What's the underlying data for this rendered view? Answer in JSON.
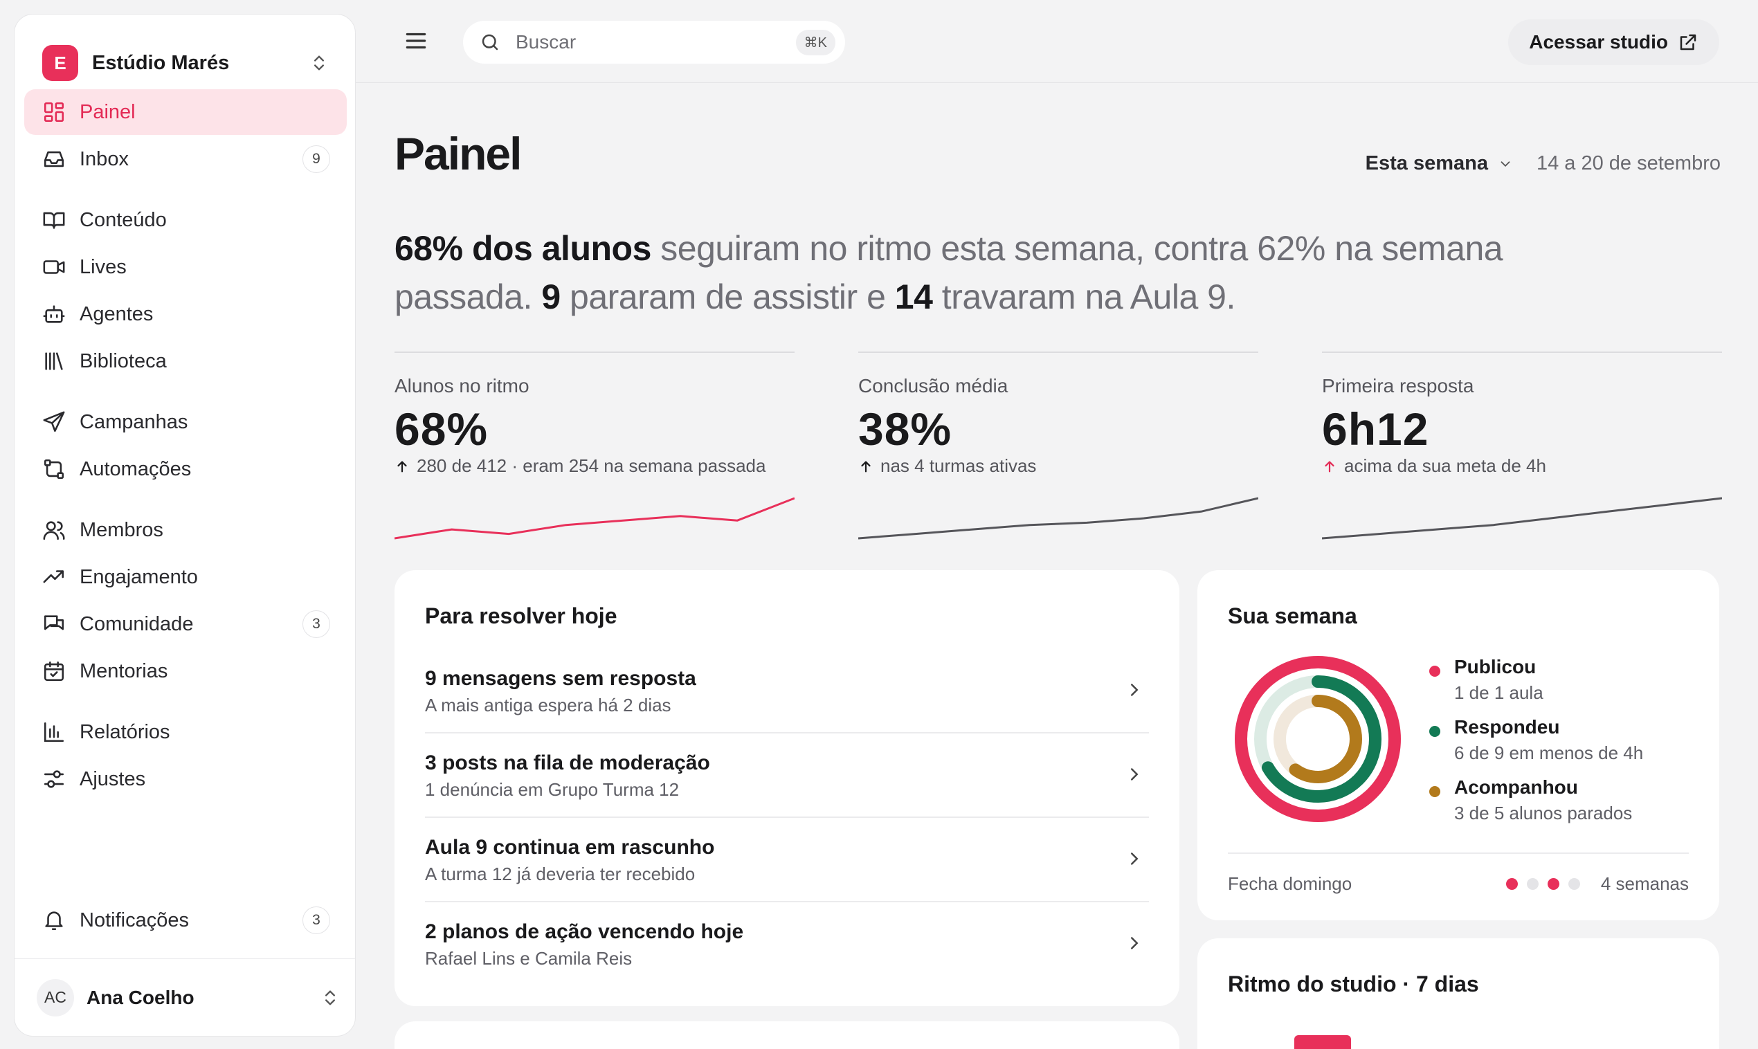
{
  "colors": {
    "accent": "#e8305a",
    "green": "#137a55",
    "amber": "#b27a1c",
    "muted_line": "#55555a"
  },
  "workspace": {
    "initial": "E",
    "name": "Estúdio Marés"
  },
  "nav": [
    {
      "label": "Painel",
      "icon": "dashboard-icon",
      "active": true
    },
    {
      "label": "Inbox",
      "icon": "inbox-icon",
      "count": "9"
    },
    {
      "label": "Conteúdo",
      "icon": "book-open-icon"
    },
    {
      "label": "Lives",
      "icon": "video-icon"
    },
    {
      "label": "Agentes",
      "icon": "bot-icon"
    },
    {
      "label": "Biblioteca",
      "icon": "library-icon"
    },
    {
      "label": "Campanhas",
      "icon": "send-icon"
    },
    {
      "label": "Automações",
      "icon": "workflow-icon"
    },
    {
      "label": "Membros",
      "icon": "users-icon"
    },
    {
      "label": "Engajamento",
      "icon": "trending-up-icon"
    },
    {
      "label": "Comunidade",
      "icon": "chat-bubbles-icon",
      "count": "3"
    },
    {
      "label": "Mentorias",
      "icon": "calendar-check-icon"
    },
    {
      "label": "Relatórios",
      "icon": "bar-chart-icon"
    },
    {
      "label": "Ajustes",
      "icon": "sliders-icon"
    }
  ],
  "notifications": {
    "label": "Notificações",
    "count": "3"
  },
  "user": {
    "initials": "AC",
    "name": "Ana Coelho"
  },
  "topbar": {
    "search_placeholder": "Buscar",
    "shortcut": "⌘K",
    "studio_button": "Acessar studio"
  },
  "page": {
    "title": "Painel",
    "period": "Esta semana",
    "dates": "14 a 20 de setembro"
  },
  "headline": {
    "p1": "68% dos alunos",
    "p2": " seguiram no ritmo esta semana, contra 62% na semana passada. ",
    "p3": "9",
    "p4": " pararam de assistir e ",
    "p5": "14",
    "p6": " travaram na Aula 9."
  },
  "kpis": [
    {
      "label": "Alunos no ritmo",
      "value": "68%",
      "note": "280 de 412 · eram 254 na semana passada",
      "trend": [
        1,
        3,
        2,
        4,
        5,
        6,
        5,
        10
      ],
      "color": "#e8305a",
      "arrow_color": "#1a1a1c"
    },
    {
      "label": "Conclusão média",
      "value": "38%",
      "note": "nas 4 turmas ativas",
      "trend": [
        1,
        2,
        3,
        4,
        4.5,
        5.5,
        7,
        10
      ],
      "color": "#55555a",
      "arrow_color": "#1a1a1c"
    },
    {
      "label": "Primeira resposta",
      "value": "6h12",
      "note": "acima da sua meta de 4h",
      "trend": [
        1,
        2,
        3,
        4,
        5.5,
        7,
        8.5,
        10
      ],
      "color": "#55555a",
      "arrow_color": "#e32a55"
    }
  ],
  "todo": {
    "title": "Para resolver hoje",
    "items": [
      {
        "title": "9 mensagens sem resposta",
        "sub": "A mais antiga espera há 2 dias"
      },
      {
        "title": "3 posts na fila de moderação",
        "sub": "1 denúncia em Grupo Turma 12"
      },
      {
        "title": "Aula 9 continua em rascunho",
        "sub": "A turma 12 já deveria ter recebido"
      },
      {
        "title": "2 planos de ação vencendo hoje",
        "sub": "Rafael Lins e Camila Reis"
      }
    ]
  },
  "week": {
    "title": "Sua semana",
    "rings": [
      {
        "name": "Publicou",
        "detail": "1 de 1 aula",
        "progress": 1.0,
        "color": "#e8305a"
      },
      {
        "name": "Respondeu",
        "detail": "6 de 9 em menos de 4h",
        "progress": 0.667,
        "color": "#137a55"
      },
      {
        "name": "Acompanhou",
        "detail": "3 de 5 alunos parados",
        "progress": 0.6,
        "color": "#b27a1c"
      }
    ],
    "closes": "Fecha domingo",
    "weeks_label": "4 semanas",
    "weeks_dots": [
      "#e8305a",
      "#e4e4e7",
      "#e8305a",
      "#e4e4e7"
    ]
  },
  "rhythm": {
    "title": "Ritmo do studio · 7 dias"
  }
}
